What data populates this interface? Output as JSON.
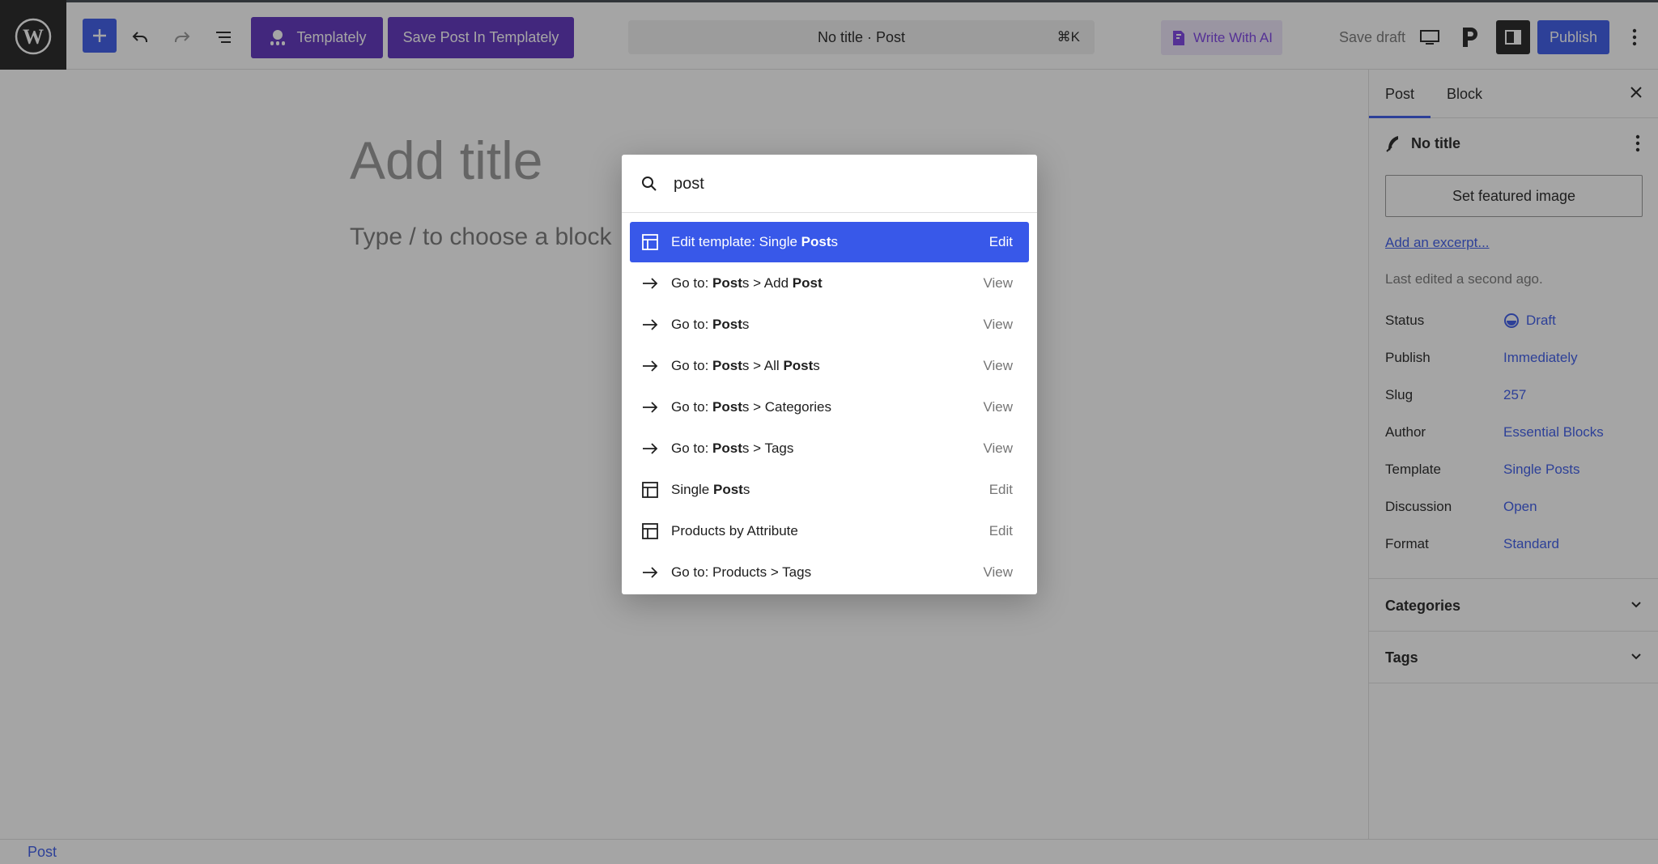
{
  "toolbar": {
    "templately_label": "Templately",
    "save_templately_label": "Save Post In Templately",
    "command_title": "No title · Post",
    "command_shortcut": "⌘K",
    "write_ai_label": "Write With AI",
    "save_draft_label": "Save draft",
    "publish_label": "Publish"
  },
  "editor": {
    "title_placeholder": "Add title",
    "block_hint": "Type / to choose a block"
  },
  "sidebar": {
    "tabs": [
      "Post",
      "Block"
    ],
    "post_title": "No title",
    "featured_image_label": "Set featured image",
    "excerpt_link": "Add an excerpt...",
    "last_edited": "Last edited a second ago.",
    "meta": [
      {
        "key": "Status",
        "value": "Draft"
      },
      {
        "key": "Publish",
        "value": "Immediately"
      },
      {
        "key": "Slug",
        "value": "257"
      },
      {
        "key": "Author",
        "value": "Essential Blocks"
      },
      {
        "key": "Template",
        "value": "Single Posts"
      },
      {
        "key": "Discussion",
        "value": "Open"
      },
      {
        "key": "Format",
        "value": "Standard"
      }
    ],
    "panels": [
      "Categories",
      "Tags"
    ]
  },
  "footer": {
    "breadcrumb": "Post"
  },
  "palette": {
    "query": "post",
    "results": [
      {
        "icon": "template-icon",
        "parts": [
          {
            "t": "Edit template: Single "
          },
          {
            "t": "Post",
            "b": true
          },
          {
            "t": "s"
          }
        ],
        "action": "Edit",
        "active": true
      },
      {
        "icon": "arrow-right-icon",
        "parts": [
          {
            "t": "Go to: "
          },
          {
            "t": "Post",
            "b": true
          },
          {
            "t": "s > Add "
          },
          {
            "t": "Post",
            "b": true
          }
        ],
        "action": "View"
      },
      {
        "icon": "arrow-right-icon",
        "parts": [
          {
            "t": "Go to: "
          },
          {
            "t": "Post",
            "b": true
          },
          {
            "t": "s"
          }
        ],
        "action": "View"
      },
      {
        "icon": "arrow-right-icon",
        "parts": [
          {
            "t": "Go to: "
          },
          {
            "t": "Post",
            "b": true
          },
          {
            "t": "s > All "
          },
          {
            "t": "Post",
            "b": true
          },
          {
            "t": "s"
          }
        ],
        "action": "View"
      },
      {
        "icon": "arrow-right-icon",
        "parts": [
          {
            "t": "Go to: "
          },
          {
            "t": "Post",
            "b": true
          },
          {
            "t": "s > Categories"
          }
        ],
        "action": "View"
      },
      {
        "icon": "arrow-right-icon",
        "parts": [
          {
            "t": "Go to: "
          },
          {
            "t": "Post",
            "b": true
          },
          {
            "t": "s > Tags"
          }
        ],
        "action": "View"
      },
      {
        "icon": "template-icon",
        "parts": [
          {
            "t": "Single "
          },
          {
            "t": "Post",
            "b": true
          },
          {
            "t": "s"
          }
        ],
        "action": "Edit"
      },
      {
        "icon": "template-icon",
        "parts": [
          {
            "t": "Products by Attribute"
          }
        ],
        "action": "Edit"
      },
      {
        "icon": "arrow-right-icon",
        "parts": [
          {
            "t": "Go to: Products > Tags"
          }
        ],
        "action": "View"
      }
    ]
  },
  "colors": {
    "accent": "#3858e9",
    "templately": "#5b2ebd",
    "ai": "#7b3fe4"
  }
}
